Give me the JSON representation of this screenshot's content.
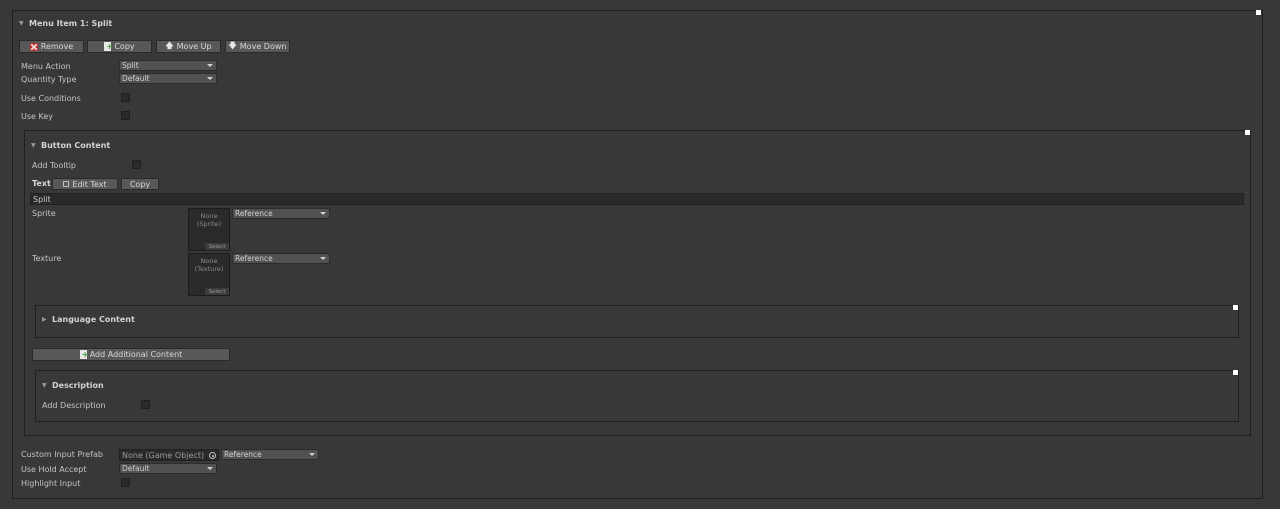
{
  "menu_item": {
    "title": "Menu Item 1: Split",
    "buttons": {
      "remove": "Remove",
      "copy": "Copy",
      "move_up": "Move Up",
      "move_down": "Move Down"
    },
    "menu_action": {
      "label": "Menu Action",
      "value": "Split"
    },
    "quantity_type": {
      "label": "Quantity Type",
      "value": "Default"
    },
    "use_conditions": {
      "label": "Use Conditions"
    },
    "use_key": {
      "label": "Use Key"
    }
  },
  "button_content": {
    "title": "Button Content",
    "add_tooltip": {
      "label": "Add Tooltip"
    },
    "text": {
      "label": "Text",
      "edit_text": "Edit Text",
      "copy": "Copy",
      "value": "Split"
    },
    "sprite": {
      "label": "Sprite",
      "none": "None (Sprite)",
      "select": "Select",
      "dropdown": "Reference"
    },
    "texture": {
      "label": "Texture",
      "none": "None (Texture)",
      "select": "Select",
      "dropdown": "Reference"
    },
    "language_content": {
      "title": "Language Content"
    },
    "add_additional_content": "Add Additional Content",
    "description": {
      "title": "Description",
      "add_description": "Add Description"
    }
  },
  "footer": {
    "custom_input_prefab": {
      "label": "Custom Input Prefab",
      "value": "None (Game Object)",
      "dropdown": "Reference"
    },
    "use_hold_accept": {
      "label": "Use Hold Accept",
      "value": "Default"
    },
    "highlight_input": {
      "label": "Highlight Input"
    }
  }
}
